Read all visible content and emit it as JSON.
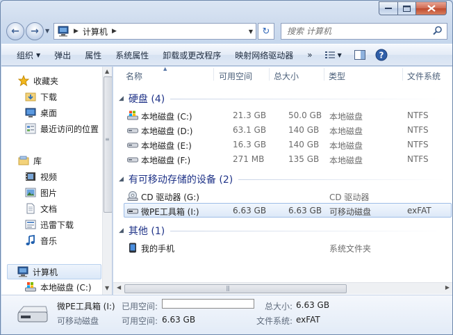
{
  "window": {
    "caption_buttons": [
      "minimize",
      "maximize",
      "close"
    ]
  },
  "address": {
    "crumbs": [
      "计算机"
    ],
    "search_placeholder": "搜索 计算机"
  },
  "toolbar": {
    "organize": "组织",
    "eject": "弹出",
    "properties": "属性",
    "system_properties": "系统属性",
    "uninstall": "卸载或更改程序",
    "map_drive": "映射网络驱动器",
    "more": "»"
  },
  "nav": {
    "favorites": "收藏夹",
    "downloads": "下载",
    "desktop": "桌面",
    "recent": "最近访问的位置",
    "libraries": "库",
    "videos": "视频",
    "pictures": "图片",
    "documents": "文档",
    "xunlei": "迅雷下载",
    "music": "音乐",
    "computer": "计算机",
    "local_c": "本地磁盘 (C:)"
  },
  "columns": {
    "name": "名称",
    "free": "可用空间",
    "total": "总大小",
    "type": "类型",
    "fs": "文件系统"
  },
  "groups": {
    "hdd": "硬盘 (4)",
    "removable": "有可移动存储的设备 (2)",
    "other": "其他 (1)"
  },
  "drives": [
    {
      "name": "本地磁盘 (C:)",
      "free": "21.3 GB",
      "total": "50.0 GB",
      "type": "本地磁盘",
      "fs": "NTFS"
    },
    {
      "name": "本地磁盘 (D:)",
      "free": "63.1 GB",
      "total": "140 GB",
      "type": "本地磁盘",
      "fs": "NTFS"
    },
    {
      "name": "本地磁盘 (E:)",
      "free": "16.3 GB",
      "total": "140 GB",
      "type": "本地磁盘",
      "fs": "NTFS"
    },
    {
      "name": "本地磁盘 (F:)",
      "free": "271 MB",
      "total": "135 GB",
      "type": "本地磁盘",
      "fs": "NTFS"
    }
  ],
  "removable": [
    {
      "name": "CD 驱动器 (G:)",
      "free": "",
      "total": "",
      "type": "CD 驱动器",
      "fs": ""
    },
    {
      "name": "微PE工具箱 (I:)",
      "free": "6.63 GB",
      "total": "6.63 GB",
      "type": "可移动磁盘",
      "fs": "exFAT"
    }
  ],
  "other": [
    {
      "name": "我的手机",
      "type": "系统文件夹"
    }
  ],
  "details": {
    "name": "微PE工具箱 (I:)",
    "kind": "可移动磁盘",
    "used_label": "已用空间:",
    "free_label": "可用空间:",
    "free_value": "6.63 GB",
    "total_label": "总大小:",
    "total_value": "6.63 GB",
    "fs_label": "文件系统:",
    "fs_value": "exFAT",
    "used_fraction": 0
  },
  "colors": {
    "group_heading": "#1e3287",
    "selection_border": "#9ebde6"
  }
}
